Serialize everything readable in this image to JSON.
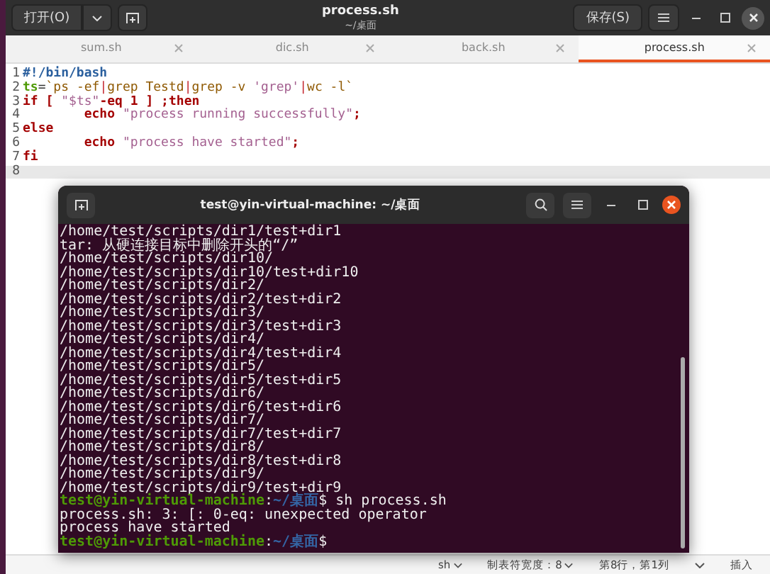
{
  "editor": {
    "title": "process.sh",
    "subtitle": "~/桌面",
    "open_button": "打开(O)",
    "save_button": "保存(S)",
    "tabs": [
      {
        "label": "sum.sh",
        "selected": false
      },
      {
        "label": "dic.sh",
        "selected": false
      },
      {
        "label": "back.sh",
        "selected": false
      },
      {
        "label": "process.sh",
        "selected": true
      }
    ],
    "lines": [
      {
        "number": "1",
        "current": false,
        "tokens": [
          {
            "text": "#!/bin/bash",
            "kind": "shebang"
          }
        ]
      },
      {
        "number": "2",
        "current": false,
        "tokens": [
          {
            "text": "ts",
            "kind": "var"
          },
          {
            "text": "=",
            "kind": "plain"
          },
          {
            "text": "`ps -ef",
            "kind": "cmd"
          },
          {
            "text": "|",
            "kind": "op"
          },
          {
            "text": "grep Testd",
            "kind": "cmd"
          },
          {
            "text": "|",
            "kind": "op"
          },
          {
            "text": "grep -v ",
            "kind": "cmd"
          },
          {
            "text": "'grep'",
            "kind": "string"
          },
          {
            "text": "|",
            "kind": "op"
          },
          {
            "text": "wc -l`",
            "kind": "cmd"
          }
        ]
      },
      {
        "number": "3",
        "current": false,
        "tokens": [
          {
            "text": "if",
            "kind": "keyword"
          },
          {
            "text": " [ ",
            "kind": "keyword"
          },
          {
            "text": "\"$ts\"",
            "kind": "string"
          },
          {
            "text": "-eq 1 ] ;",
            "kind": "keyword"
          },
          {
            "text": "then",
            "kind": "keyword"
          }
        ]
      },
      {
        "number": "4",
        "current": false,
        "tokens": [
          {
            "text": "        echo",
            "kind": "keyword"
          },
          {
            "text": " \"process running successfully\"",
            "kind": "string"
          },
          {
            "text": ";",
            "kind": "keyword"
          }
        ]
      },
      {
        "number": "5",
        "current": false,
        "tokens": [
          {
            "text": "else",
            "kind": "keyword"
          }
        ]
      },
      {
        "number": "6",
        "current": false,
        "tokens": [
          {
            "text": "        echo",
            "kind": "keyword"
          },
          {
            "text": " \"process have started\"",
            "kind": "string"
          },
          {
            "text": ";",
            "kind": "keyword"
          }
        ]
      },
      {
        "number": "7",
        "current": false,
        "tokens": [
          {
            "text": "fi",
            "kind": "keyword"
          }
        ]
      },
      {
        "number": "8",
        "current": true
      }
    ],
    "status_bar": {
      "language": "sh",
      "tab_width": "制表符宽度：8",
      "position": "第8行，第1列",
      "mode": "插入"
    }
  },
  "terminal": {
    "title": "test@yin-virtual-machine: ~/桌面",
    "lines": [
      {
        "kind": "output",
        "text": "/home/test/scripts/dir1/test+dir1"
      },
      {
        "kind": "output",
        "text": "tar: 从硬连接目标中删除开头的“/”"
      },
      {
        "kind": "output",
        "text": "/home/test/scripts/dir10/"
      },
      {
        "kind": "output",
        "text": "/home/test/scripts/dir10/test+dir10"
      },
      {
        "kind": "output",
        "text": "/home/test/scripts/dir2/"
      },
      {
        "kind": "output",
        "text": "/home/test/scripts/dir2/test+dir2"
      },
      {
        "kind": "output",
        "text": "/home/test/scripts/dir3/"
      },
      {
        "kind": "output",
        "text": "/home/test/scripts/dir3/test+dir3"
      },
      {
        "kind": "output",
        "text": "/home/test/scripts/dir4/"
      },
      {
        "kind": "output",
        "text": "/home/test/scripts/dir4/test+dir4"
      },
      {
        "kind": "output",
        "text": "/home/test/scripts/dir5/"
      },
      {
        "kind": "output",
        "text": "/home/test/scripts/dir5/test+dir5"
      },
      {
        "kind": "output",
        "text": "/home/test/scripts/dir6/"
      },
      {
        "kind": "output",
        "text": "/home/test/scripts/dir6/test+dir6"
      },
      {
        "kind": "output",
        "text": "/home/test/scripts/dir7/"
      },
      {
        "kind": "output",
        "text": "/home/test/scripts/dir7/test+dir7"
      },
      {
        "kind": "output",
        "text": "/home/test/scripts/dir8/"
      },
      {
        "kind": "output",
        "text": "/home/test/scripts/dir8/test+dir8"
      },
      {
        "kind": "output",
        "text": "/home/test/scripts/dir9/"
      },
      {
        "kind": "output",
        "text": "/home/test/scripts/dir9/test+dir9"
      },
      {
        "kind": "prompt",
        "user": "test@yin-virtual-machine",
        "separator": ":",
        "path": "~/桌面",
        "command": "$ sh process.sh"
      },
      {
        "kind": "output",
        "text": "process.sh: 3: [: 0-eq: unexpected operator"
      },
      {
        "kind": "output",
        "text": "process have started"
      },
      {
        "kind": "prompt",
        "user": "test@yin-virtual-machine",
        "separator": ":",
        "path": "~/桌面",
        "command": "$"
      }
    ]
  }
}
